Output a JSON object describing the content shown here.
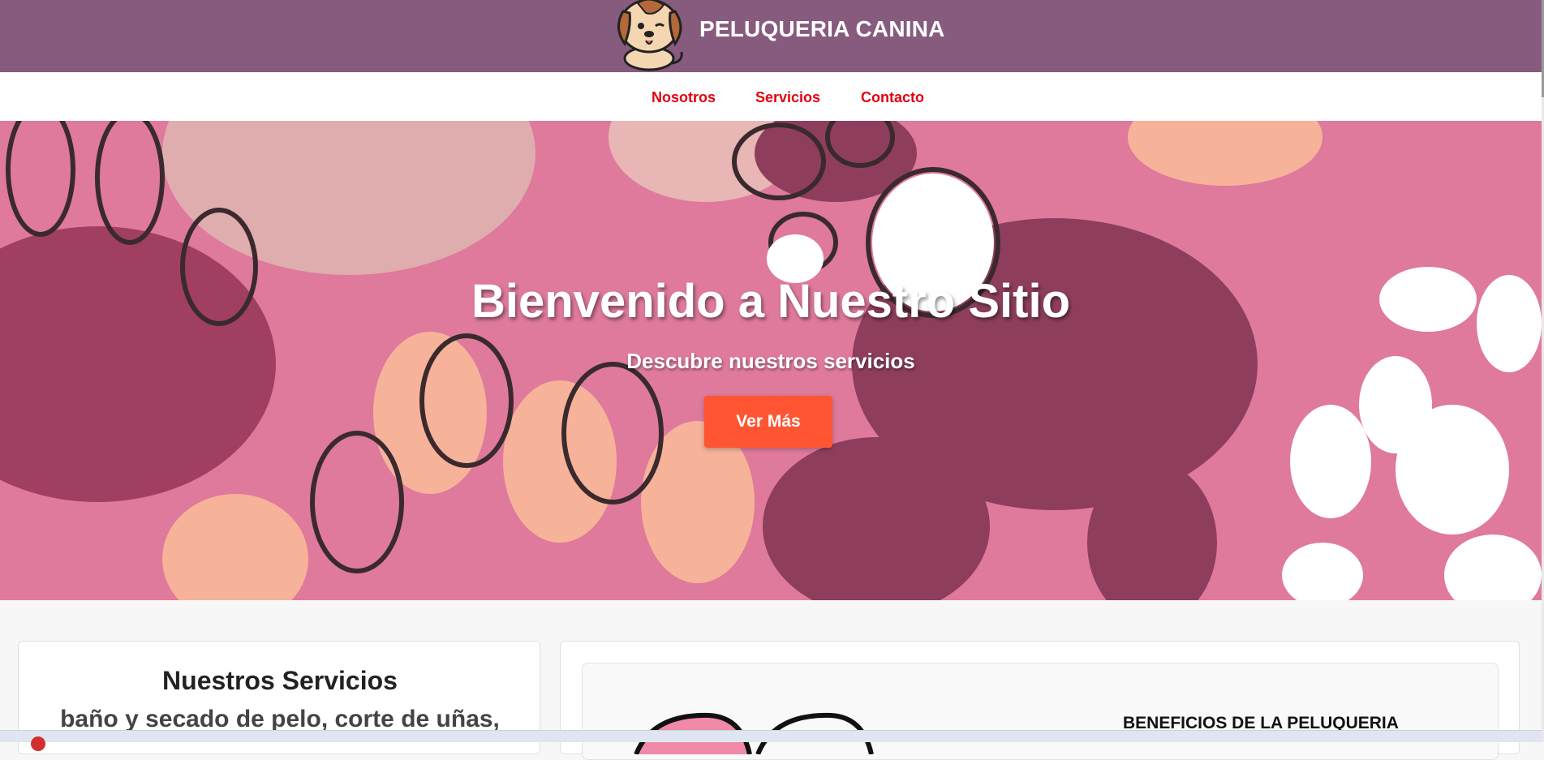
{
  "header": {
    "brand": "PELUQUERIA CANINA",
    "logo_icon": "dog-mascot-icon",
    "background_color": "#875b7e"
  },
  "nav": {
    "items": [
      {
        "label": "Nosotros"
      },
      {
        "label": "Servicios"
      },
      {
        "label": "Contacto"
      }
    ],
    "link_color": "#e3000f"
  },
  "hero": {
    "title": "Bienvenido a Nuestro Sitio",
    "subtitle": "Descubre nuestros servicios",
    "button_label": "Ver Más",
    "button_color": "#ff5533",
    "background_pattern": "paw-prints-pattern"
  },
  "services": {
    "title": "Nuestros Servicios",
    "text": "baño y secado de pelo, corte de uñas,"
  },
  "benefits": {
    "title": "BENEFICIOS DE LA PELUQUERIA"
  }
}
